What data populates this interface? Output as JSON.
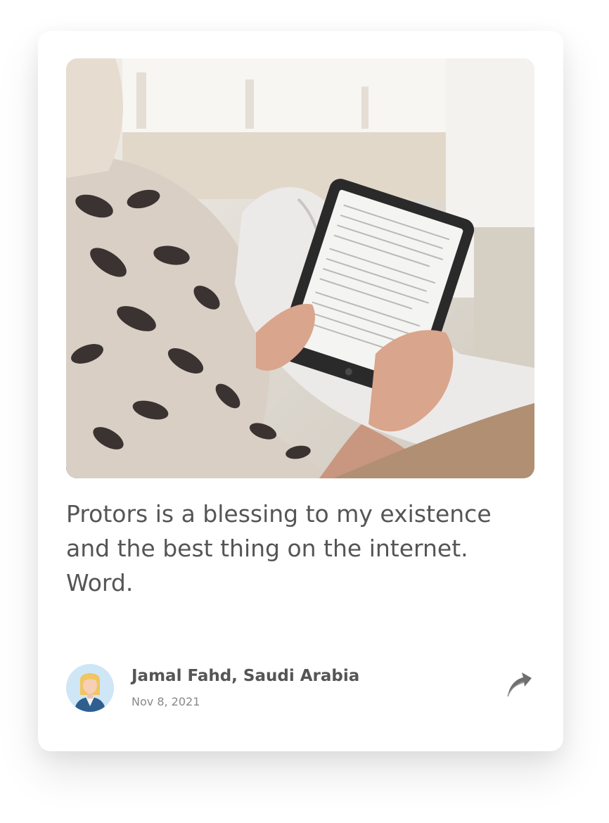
{
  "testimonial": {
    "quote": "Protors is a blessing to my existence and the best thing on the internet. Word.",
    "author_name": "Jamal Fahd, Saudi Arabia",
    "date": "Nov 8, 2021"
  },
  "icons": {
    "share": "share-arrow-icon",
    "avatar": "user-avatar"
  },
  "colors": {
    "text": "#555555",
    "muted": "#888888",
    "card": "#ffffff"
  }
}
